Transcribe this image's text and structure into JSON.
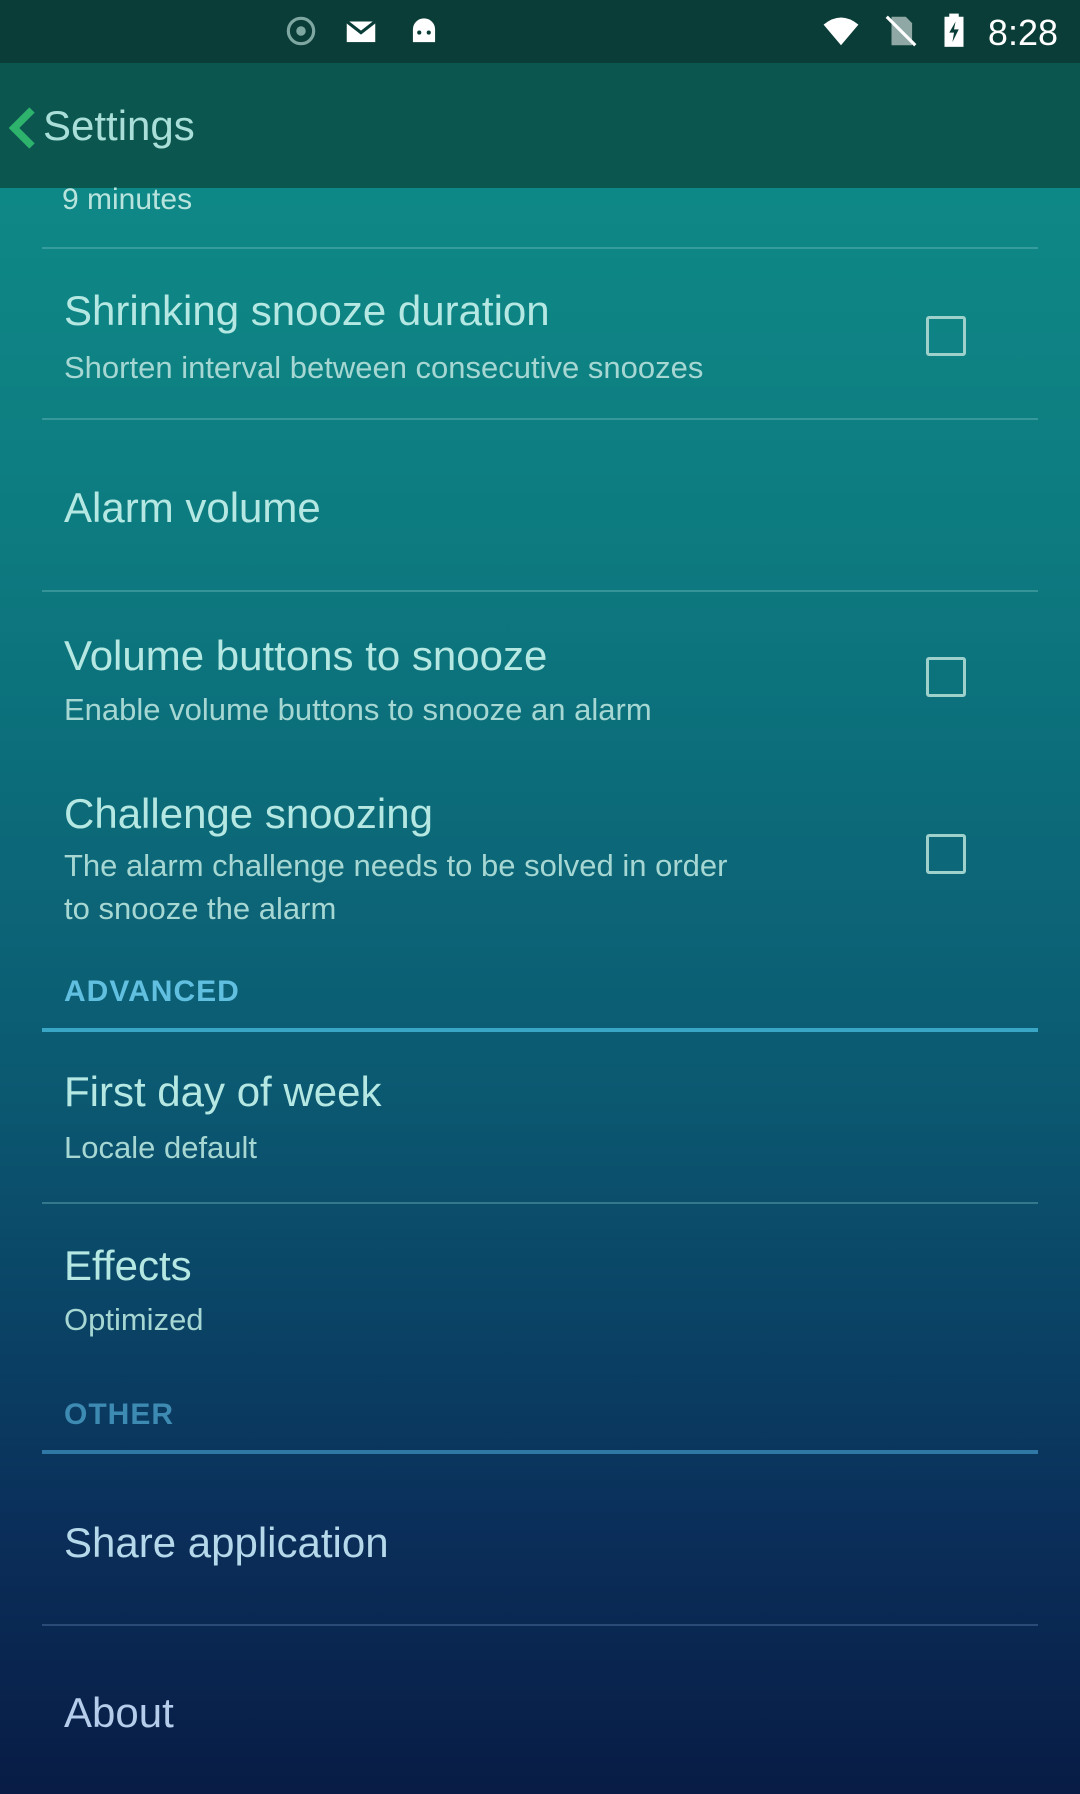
{
  "status_bar": {
    "time": "8:28",
    "icons": [
      "notification-dot-icon",
      "mail-icon",
      "android-icon",
      "wifi-icon",
      "no-sim-icon",
      "battery-charging-icon"
    ]
  },
  "toolbar": {
    "title": "Settings",
    "back_icon": "back-arrow-icon"
  },
  "prefs": {
    "partial_summary": "9 minutes",
    "shrinking": {
      "title": "Shrinking snooze duration",
      "summary": "Shorten interval between consecutive snoozes",
      "checked": false
    },
    "alarm_volume": {
      "title": "Alarm volume"
    },
    "volume_buttons": {
      "title": "Volume buttons to snooze",
      "summary": "Enable volume buttons to snooze an alarm",
      "checked": false
    },
    "challenge": {
      "title": "Challenge snoozing",
      "summary_line1": "The alarm challenge needs to be solved in order",
      "summary_line2": "to snooze the alarm",
      "checked": false
    },
    "advanced_header": "ADVANCED",
    "first_day": {
      "title": "First day of week",
      "summary": "Locale default"
    },
    "effects": {
      "title": "Effects",
      "summary": "Optimized"
    },
    "other_header": "OTHER",
    "share": {
      "title": "Share application"
    },
    "about": {
      "title": "About"
    }
  }
}
